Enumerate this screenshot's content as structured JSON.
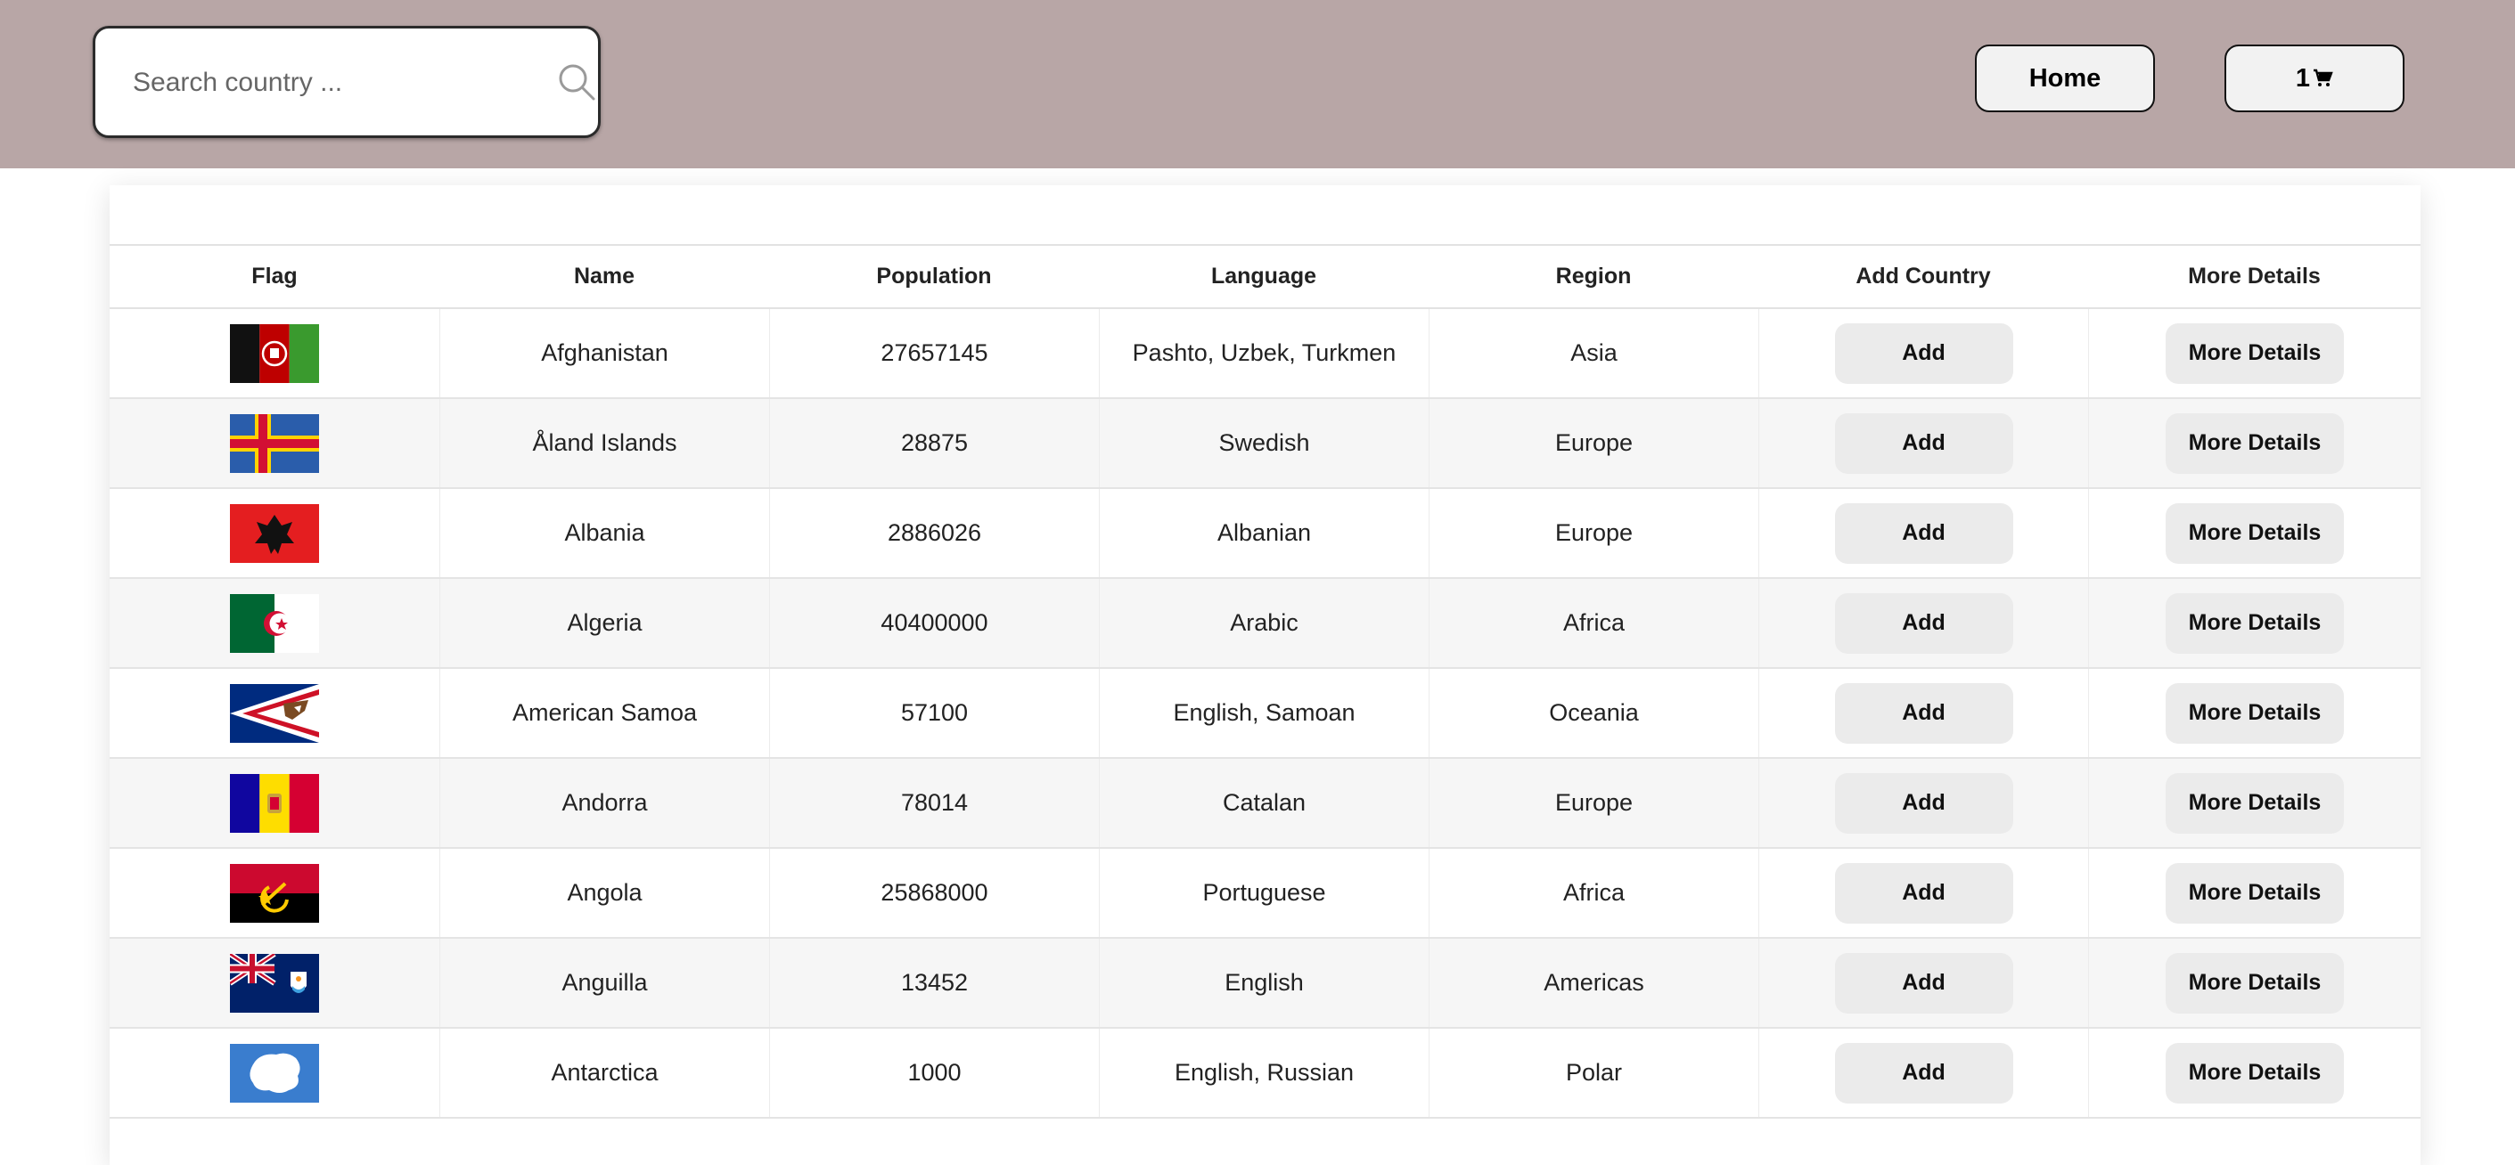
{
  "header": {
    "search_placeholder": "Search country ...",
    "home_label": "Home",
    "cart_count": "1",
    "cart_icon": "cart-icon"
  },
  "table": {
    "columns": [
      "Flag",
      "Name",
      "Population",
      "Language",
      "Region",
      "Add Country",
      "More Details"
    ],
    "add_label": "Add",
    "more_label": "More Details",
    "rows": [
      {
        "flag": "af",
        "name": "Afghanistan",
        "population": "27657145",
        "language": "Pashto, Uzbek, Turkmen",
        "region": "Asia"
      },
      {
        "flag": "ax",
        "name": "Åland Islands",
        "population": "28875",
        "language": "Swedish",
        "region": "Europe"
      },
      {
        "flag": "al",
        "name": "Albania",
        "population": "2886026",
        "language": "Albanian",
        "region": "Europe"
      },
      {
        "flag": "dz",
        "name": "Algeria",
        "population": "40400000",
        "language": "Arabic",
        "region": "Africa"
      },
      {
        "flag": "as",
        "name": "American Samoa",
        "population": "57100",
        "language": "English, Samoan",
        "region": "Oceania"
      },
      {
        "flag": "ad",
        "name": "Andorra",
        "population": "78014",
        "language": "Catalan",
        "region": "Europe"
      },
      {
        "flag": "ao",
        "name": "Angola",
        "population": "25868000",
        "language": "Portuguese",
        "region": "Africa"
      },
      {
        "flag": "ai",
        "name": "Anguilla",
        "population": "13452",
        "language": "English",
        "region": "Americas"
      },
      {
        "flag": "aq",
        "name": "Antarctica",
        "population": "1000",
        "language": "English, Russian",
        "region": "Polar"
      }
    ]
  },
  "colors": {
    "header_bg": "#b8a6a6",
    "button_bg": "#ebebeb",
    "row_alt_bg": "#f6f6f6"
  }
}
